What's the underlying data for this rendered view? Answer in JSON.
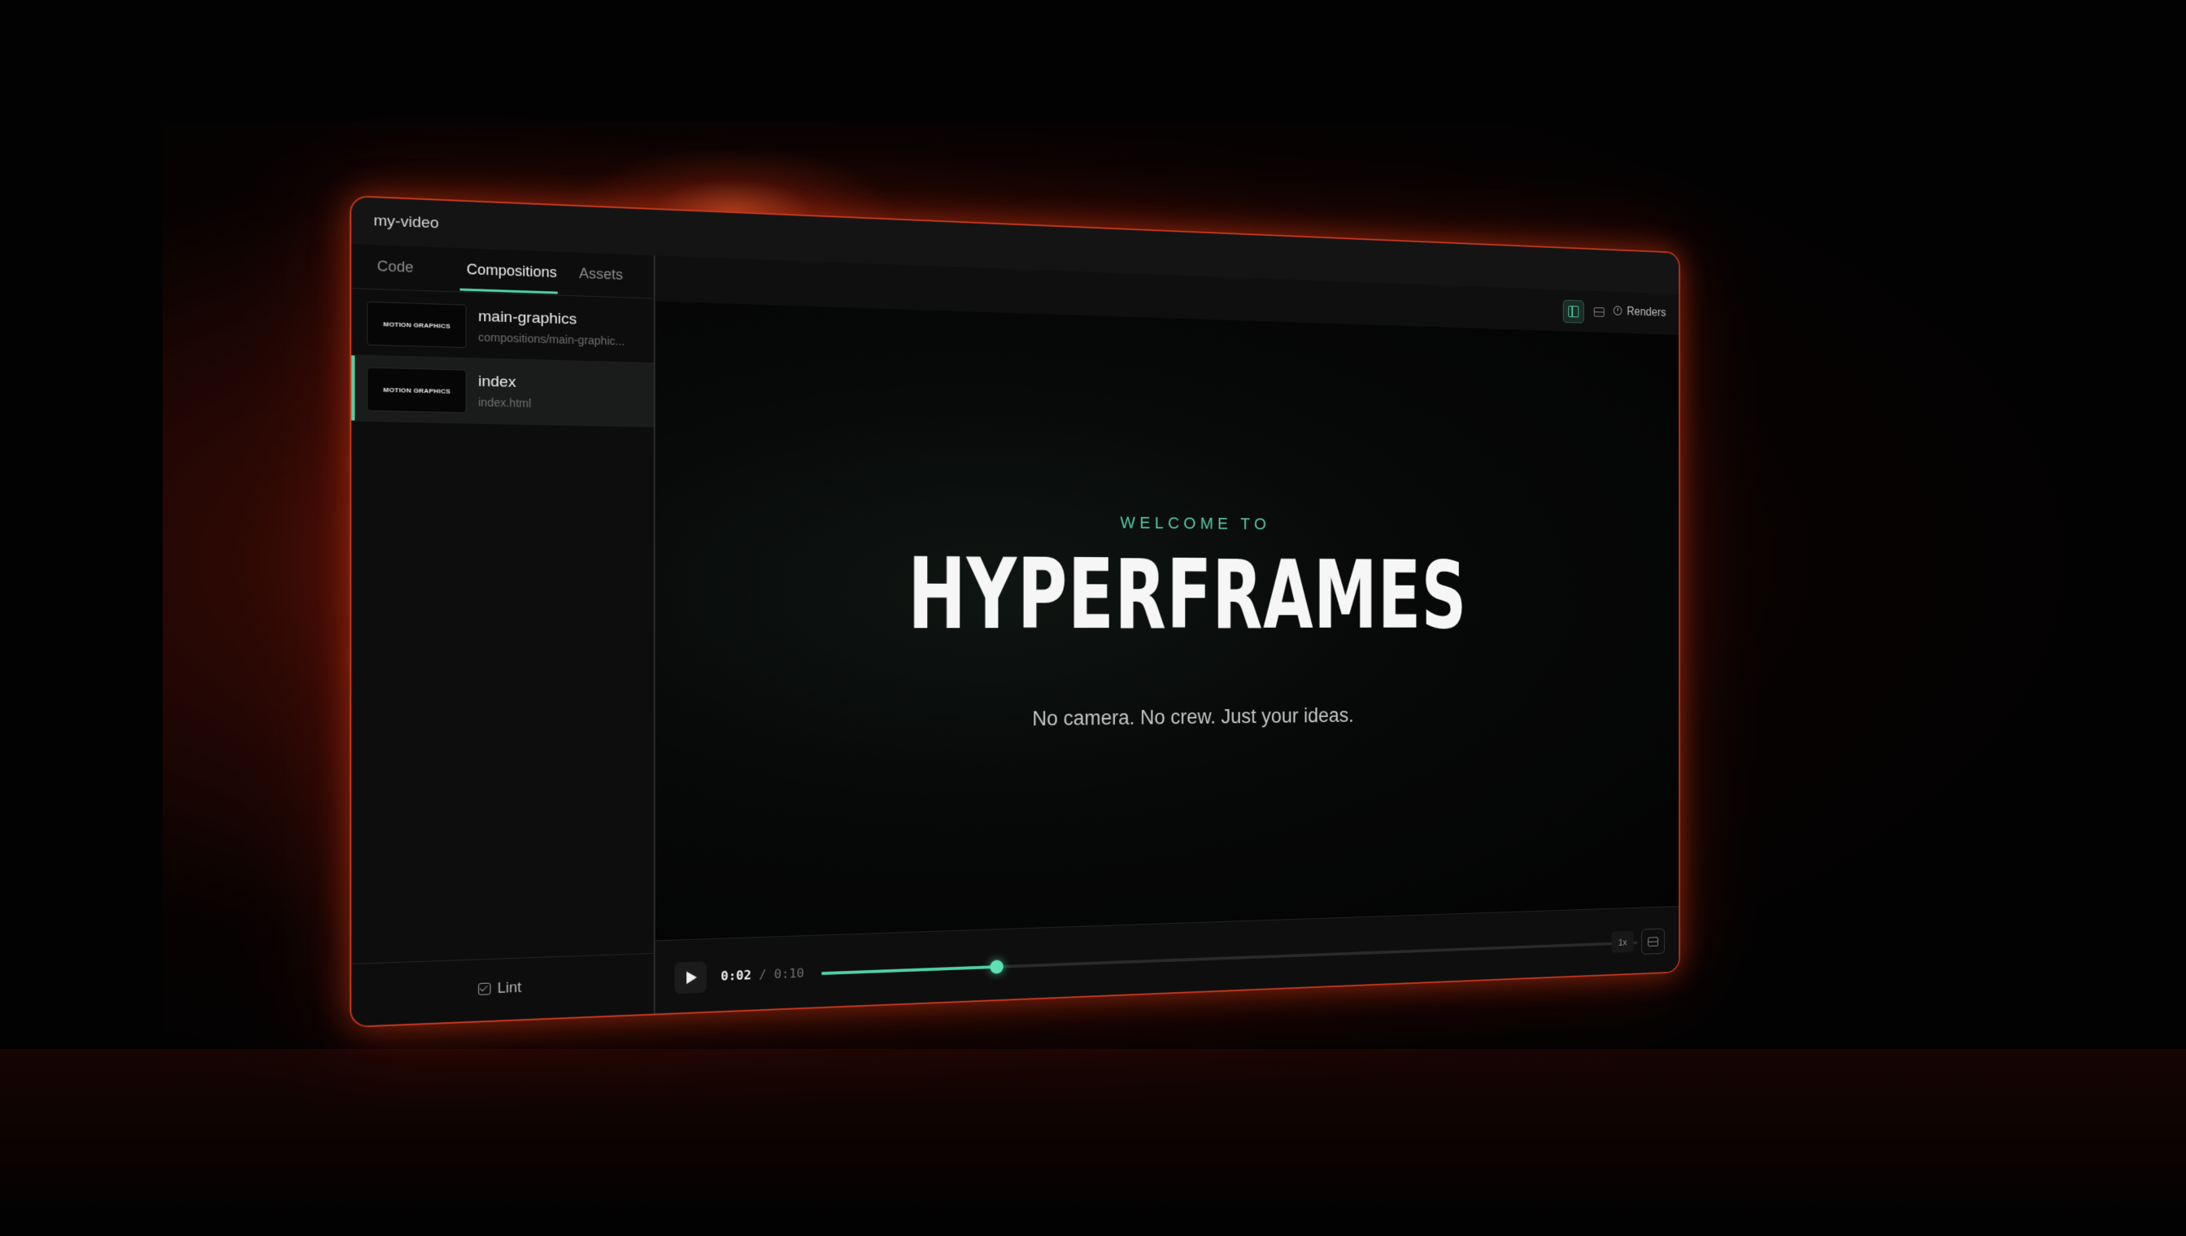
{
  "window": {
    "title": "my-video"
  },
  "sidebar": {
    "tabs": [
      {
        "label": "Code",
        "active": false
      },
      {
        "label": "Compositions",
        "active": true
      },
      {
        "label": "Assets",
        "active": false
      }
    ],
    "compositions": [
      {
        "thumb_text": "MOTION GRAPHICS",
        "name": "main-graphics",
        "path": "compositions/main-graphic...",
        "selected": false
      },
      {
        "thumb_text": "MOTION GRAPHICS",
        "name": "index",
        "path": "index.html",
        "selected": true
      }
    ],
    "lint_label": "Lint"
  },
  "toolbar": {
    "panel_icon": "panel-left-icon",
    "layout_icon": "layout-icon",
    "renders_label": "Renders"
  },
  "preview": {
    "eyebrow": "WELCOME TO",
    "headline": "HYPERFRAMES",
    "tagline": "No camera. No crew. Just your ideas."
  },
  "player": {
    "current_time": "0:02",
    "separator": "/",
    "duration": "0:10",
    "progress": 0.2,
    "speed": "1x"
  },
  "colors": {
    "accent": "#4fd1a5",
    "frame_glow": "#c2381c"
  }
}
